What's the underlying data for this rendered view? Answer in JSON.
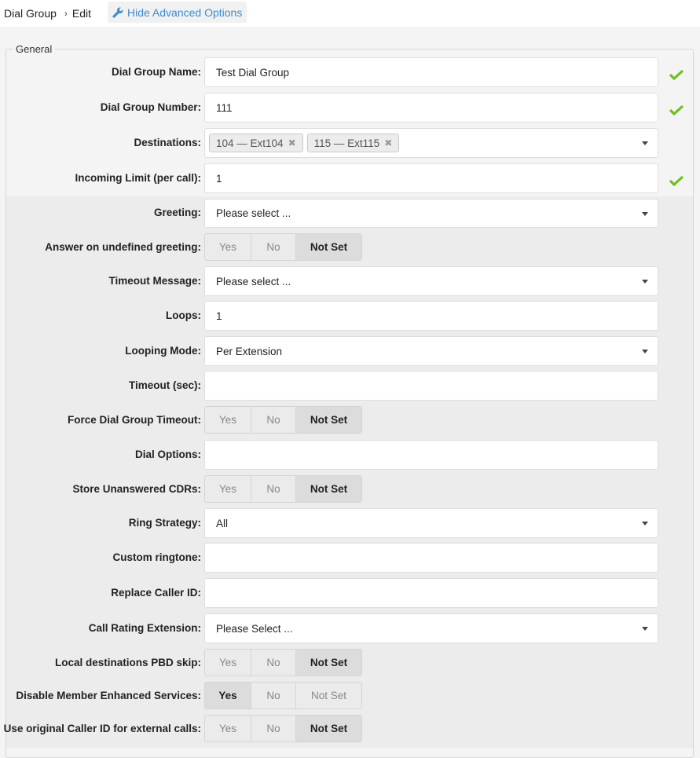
{
  "breadcrumb": {
    "root": "Dial Group",
    "separator": "›",
    "current": "Edit"
  },
  "advanced_toggle": {
    "label": "Hide Advanced Options",
    "icon": "wrench-icon",
    "color": "#3d8bd0"
  },
  "fieldset": {
    "legend": "General"
  },
  "fields": {
    "name": {
      "label": "Dial Group Name:",
      "value": "Test Dial Group",
      "valid": true
    },
    "number": {
      "label": "Dial Group Number:",
      "value": "111",
      "valid": true
    },
    "destinations": {
      "label": "Destinations:",
      "tags": [
        {
          "label": "104 — Ext104"
        },
        {
          "label": "115 — Ext115"
        }
      ]
    },
    "incoming_limit": {
      "label": "Incoming Limit (per call):",
      "value": "1",
      "valid": true
    },
    "greeting": {
      "label": "Greeting:",
      "value": "Please select ..."
    },
    "answer_undefined": {
      "label": "Answer on undefined greeting:",
      "selected": "Not Set"
    },
    "timeout_message": {
      "label": "Timeout Message:",
      "value": "Please select ..."
    },
    "loops": {
      "label": "Loops:",
      "value": "1"
    },
    "looping_mode": {
      "label": "Looping Mode:",
      "value": "Per Extension"
    },
    "timeout_sec": {
      "label": "Timeout (sec):",
      "value": ""
    },
    "force_timeout": {
      "label": "Force Dial Group Timeout:",
      "selected": "Not Set"
    },
    "dial_options": {
      "label": "Dial Options:",
      "value": ""
    },
    "store_unanswered": {
      "label": "Store Unanswered CDRs:",
      "selected": "Not Set"
    },
    "ring_strategy": {
      "label": "Ring Strategy:",
      "value": "All"
    },
    "custom_ringtone": {
      "label": "Custom ringtone:",
      "value": ""
    },
    "replace_callerid": {
      "label": "Replace Caller ID:",
      "value": ""
    },
    "call_rating": {
      "label": "Call Rating Extension:",
      "value": "Please Select ..."
    },
    "local_pbd_skip": {
      "label": "Local destinations PBD skip:",
      "selected": "Not Set"
    },
    "disable_enhanced": {
      "label": "Disable Member Enhanced Services:",
      "selected": "Yes"
    },
    "original_callerid": {
      "label": "Use original Caller ID for external calls:",
      "selected": "Not Set"
    }
  },
  "toggle_options": {
    "yes": "Yes",
    "no": "No",
    "notset": "Not Set"
  },
  "colors": {
    "valid_check": "#6cc21f",
    "link": "#3d8bd0"
  }
}
